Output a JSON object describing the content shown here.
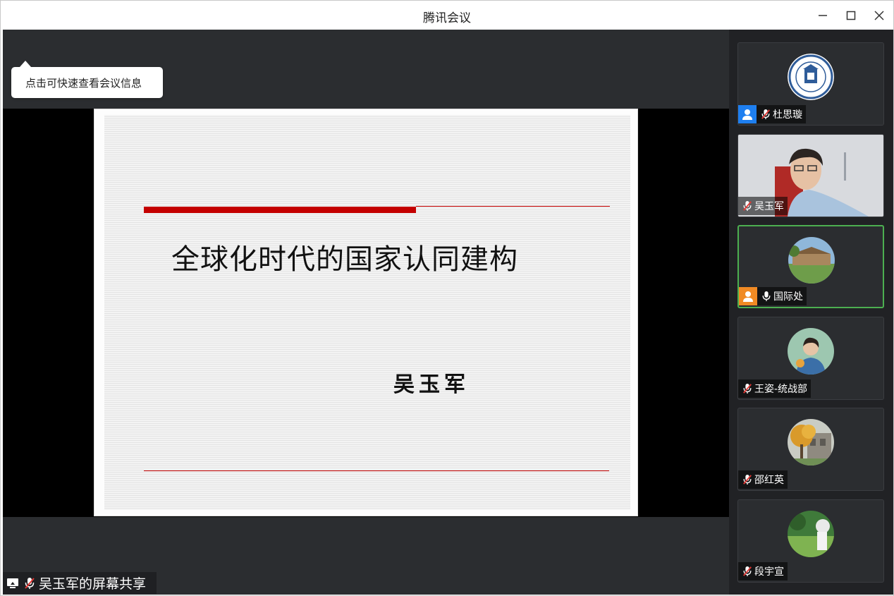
{
  "window": {
    "title": "腾讯会议"
  },
  "tooltip": {
    "text": "点击可快速查看会议信息"
  },
  "slide": {
    "title": "全球化时代的国家认同建构",
    "author": "吴玉军"
  },
  "share_label": {
    "text": "吴玉军的屏幕共享"
  },
  "participants": [
    {
      "name": "杜思璇",
      "mic": "muted",
      "avatar": "university-seal"
    },
    {
      "name": "吴玉军",
      "mic": "muted",
      "avatar": "camera-video"
    },
    {
      "name": "国际处",
      "mic": "on",
      "avatar": "campus-photo"
    },
    {
      "name": "王姿-统战部",
      "mic": "muted",
      "avatar": "person-photo"
    },
    {
      "name": "邵红英",
      "mic": "muted",
      "avatar": "autumn-tree-photo"
    },
    {
      "name": "段宇宣",
      "mic": "muted",
      "avatar": "garden-photo"
    }
  ],
  "colors": {
    "accent_red": "#c40000",
    "active_border": "#4caf50",
    "host_badge": "#1e7ff0",
    "user_badge": "#f08a24"
  }
}
